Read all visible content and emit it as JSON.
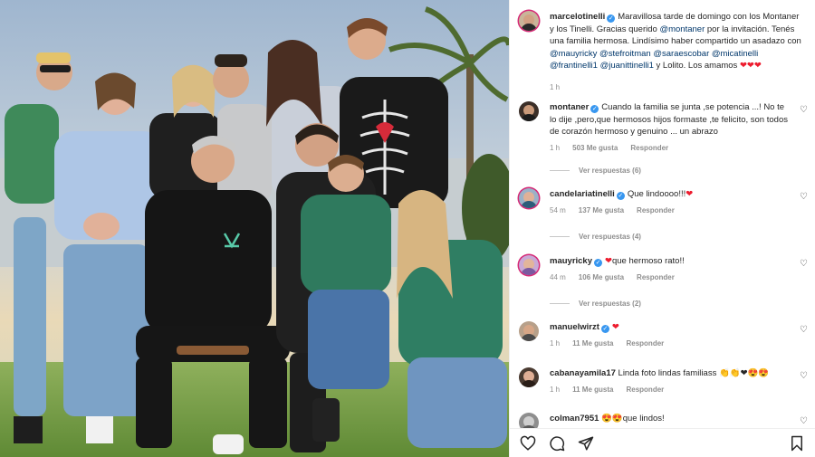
{
  "post": {
    "author": "marcelotinelli",
    "caption_parts": [
      {
        "t": "Maravillosa tarde de domingo con los Montaner y los Tinelli. Gracias querido ",
        "m": false
      },
      {
        "t": "@montaner",
        "m": true
      },
      {
        "t": " por la invitación. Tenés una familia hermosa. Lindísimo haber compartido un asadazo con ",
        "m": false
      },
      {
        "t": "@mauyricky",
        "m": true
      },
      {
        "t": " ",
        "m": false
      },
      {
        "t": "@stefroitman",
        "m": true
      },
      {
        "t": " ",
        "m": false
      },
      {
        "t": "@saraescobar",
        "m": true
      },
      {
        "t": " ",
        "m": false
      },
      {
        "t": "@micatinelli",
        "m": true
      },
      {
        "t": " ",
        "m": false
      },
      {
        "t": "@frantinelli1",
        "m": true
      },
      {
        "t": " ",
        "m": false
      },
      {
        "t": "@juanittinelli1",
        "m": true
      },
      {
        "t": " y Lolito. Los amamos ",
        "m": false
      }
    ],
    "caption_emoji": "❤❤❤",
    "time": "1 h"
  },
  "comments": [
    {
      "user": "montaner",
      "verified": true,
      "text": "Cuando la familia se junta ,se potencia ...! No te lo dije ,pero,que hermosos hijos formaste ,te felicito, son todos de corazón hermoso y genuino ... un abrazo",
      "emoji": "",
      "time": "1 h",
      "likes": "503 Me gusta",
      "reply": "Responder",
      "replies": "Ver respuestas (6)"
    },
    {
      "user": "candelariatinelli",
      "verified": true,
      "text": "Que lindoooo!!!",
      "emoji": "❤",
      "time": "54 m",
      "likes": "137 Me gusta",
      "reply": "Responder",
      "replies": "Ver respuestas (4)"
    },
    {
      "user": "mauyricky",
      "verified": true,
      "text": "que hermoso rato!!",
      "emoji_before": "❤",
      "time": "44 m",
      "likes": "106 Me gusta",
      "reply": "Responder",
      "replies": "Ver respuestas (2)"
    },
    {
      "user": "manuelwirzt",
      "verified": true,
      "text": "",
      "emoji": "❤",
      "time": "1 h",
      "likes": "11 Me gusta",
      "reply": "Responder"
    },
    {
      "user": "cabanayamila17",
      "verified": false,
      "text": "Linda foto lindas familiass ",
      "emoji": "👏👏❤😍😍",
      "time": "1 h",
      "likes": "11 Me gusta",
      "reply": "Responder"
    },
    {
      "user": "colman7951",
      "verified": false,
      "text": "que lindos!",
      "emoji_before": "😍😍"
    }
  ],
  "actions": {
    "icons": [
      "heart-icon",
      "comment-icon",
      "share-icon",
      "bookmark-icon"
    ]
  },
  "colors": {
    "verified": "#3897f0",
    "mention": "#00376b",
    "meta": "#8e8e8e",
    "heart": "#ed1c2e"
  }
}
